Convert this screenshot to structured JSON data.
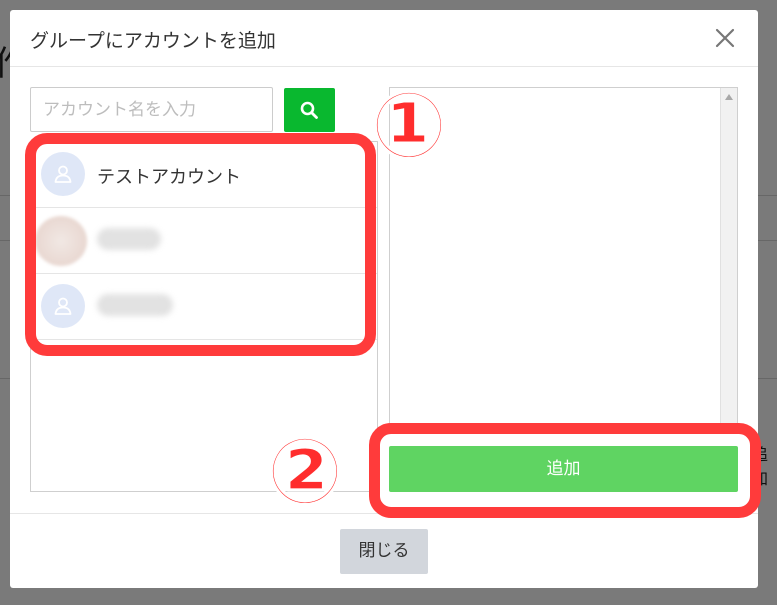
{
  "modal": {
    "title": "グループにアカウントを追加",
    "close_icon": "close-icon"
  },
  "search": {
    "placeholder": "アカウント名を入力",
    "button_icon": "search-icon",
    "button_color": "#09b82f"
  },
  "accounts": [
    {
      "name": "テストアカウント",
      "avatar": "user-icon"
    },
    {
      "name": "",
      "avatar": "photo"
    },
    {
      "name": "",
      "avatar": "user-icon"
    }
  ],
  "actions": {
    "add_label": "追加",
    "close_label": "閉じる"
  },
  "annotations": {
    "marker_1": "①",
    "marker_2": "②",
    "color": "#ff3b3b"
  },
  "background": {
    "fragment_left": "作",
    "fragment_right": "追加"
  }
}
